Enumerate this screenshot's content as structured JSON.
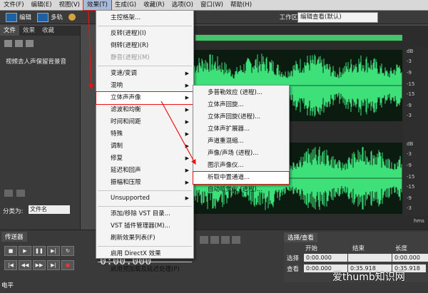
{
  "menubar": [
    "文件(F)",
    "编辑(E)",
    "视图(V)",
    "效果(T)",
    "生成(G)",
    "收藏(R)",
    "选项(O)",
    "窗口(W)",
    "帮助(H)"
  ],
  "toolbar": {
    "edit": "编辑",
    "multitrack": "多轨",
    "workspace_label": "工作区:",
    "workspace_value": "编辑查看(默认)"
  },
  "left_panel": {
    "tabs": [
      "文件",
      "效果",
      "收藏"
    ],
    "file_item": "视频去人声保留背景音",
    "sort_label": "分类为:",
    "sort_value": "文件名"
  },
  "effects_menu": [
    {
      "label": "主控格架..."
    },
    {
      "sep": true
    },
    {
      "label": "反转(进程)(I)"
    },
    {
      "label": "倒转(进程)(R)"
    },
    {
      "label": "静音(进程)(M)",
      "disabled": true
    },
    {
      "sep": true
    },
    {
      "label": "变速/变调",
      "sub": true
    },
    {
      "label": "混响",
      "sub": true
    },
    {
      "label": "立体声声像",
      "sub": true,
      "highlight": true
    },
    {
      "label": "滤波和均衡",
      "sub": true
    },
    {
      "label": "时间和间距",
      "sub": true
    },
    {
      "label": "特殊",
      "sub": true
    },
    {
      "label": "调制",
      "sub": true
    },
    {
      "label": "修复",
      "sub": true
    },
    {
      "label": "延迟和回声",
      "sub": true
    },
    {
      "label": "振幅和压限",
      "sub": true
    },
    {
      "sep": true
    },
    {
      "label": "Unsupported",
      "sub": true
    },
    {
      "sep": true
    },
    {
      "label": "添加/移除 VST 目录..."
    },
    {
      "label": "VST 插件管理器(M)..."
    },
    {
      "label": "刷新效果列表(F)"
    },
    {
      "sep": true
    },
    {
      "label": "启用 DirectX 效果"
    },
    {
      "sep": true
    },
    {
      "label": "启用预加载及延迟处理(P)"
    }
  ],
  "stereo_submenu": [
    {
      "label": "多普勒效应 (进程)..."
    },
    {
      "label": "立体声回旋..."
    },
    {
      "label": "立体声回旋(进程)..."
    },
    {
      "label": "立体声扩展器..."
    },
    {
      "label": "声道重混缩..."
    },
    {
      "label": "声像/声场 (进程)..."
    },
    {
      "label": "图示声像仪..."
    },
    {
      "label": "析取中置通道...",
      "highlight": true
    },
    {
      "label": "自动听觉仪 (进程)..."
    }
  ],
  "db_scale_top": [
    "dB",
    "-3",
    "-9",
    "-15",
    "-15",
    "-9",
    "-3"
  ],
  "db_scale_bottom": [
    "dB",
    "-3",
    "-9",
    "-15",
    "-15",
    "-9",
    "-3"
  ],
  "time_unit": "hms",
  "transport": {
    "tab": "传送器",
    "timecode": "0:00.000"
  },
  "selection_panel": {
    "tab": "选择/查看",
    "headers": [
      "开始",
      "结束",
      "长度"
    ],
    "rows": [
      {
        "label": "选择",
        "values": [
          "0:00.000",
          "",
          "0:00.000"
        ]
      },
      {
        "label": "查看",
        "values": [
          "0:00.000",
          "0:35.918",
          "0:35.918"
        ]
      }
    ]
  },
  "level_tab": "电平",
  "watermark": "爱thumb知识网",
  "colors": {
    "waveform": "#3ee07a",
    "menu_highlight_border": "#e11111",
    "timebar": "#43c56a"
  }
}
